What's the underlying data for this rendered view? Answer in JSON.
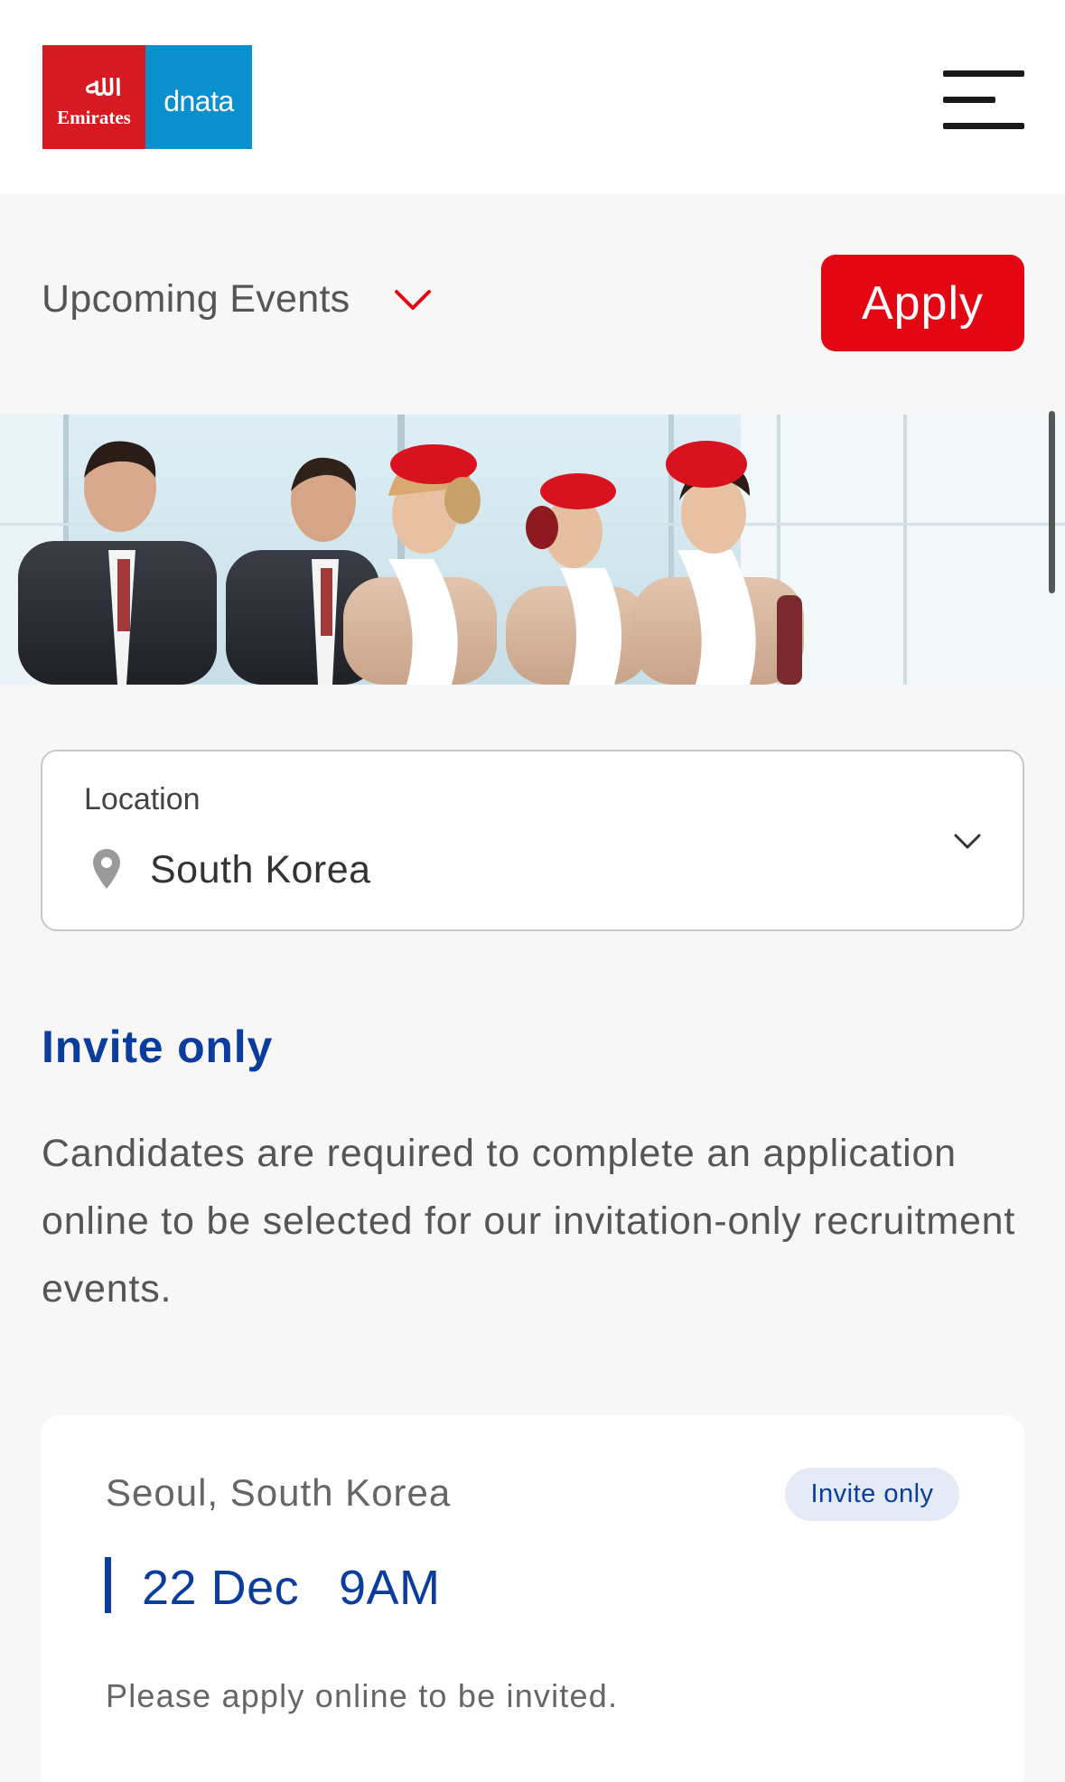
{
  "header": {
    "logo_left_text": "Emirates",
    "logo_left_mark": "ﷲ",
    "logo_right_text": "dnata",
    "menu_icon": "hamburger-menu-icon"
  },
  "events_bar": {
    "select_label": "Upcoming Events",
    "select_icon": "chevron-down-icon",
    "apply_label": "Apply"
  },
  "location": {
    "caption": "Location",
    "value": "South Korea",
    "icon": "location-pin-icon",
    "dropdown_icon": "chevron-down-icon"
  },
  "invite": {
    "heading": "Invite only",
    "description": "Candidates are required to complete an application online to be selected for our invitation-only recruitment events."
  },
  "events": [
    {
      "city": "Seoul, South Korea",
      "badge": "Invite only",
      "date": "22 Dec",
      "time": "9AM",
      "note": "Please apply online to be invited."
    }
  ],
  "colors": {
    "brand_red": "#e30613",
    "emirates_red": "#d71921",
    "dnata_blue": "#0a8fcf",
    "accent_blue": "#0a3d9e",
    "badge_bg": "#e4ebf6",
    "page_bg": "#f7f7f7"
  }
}
